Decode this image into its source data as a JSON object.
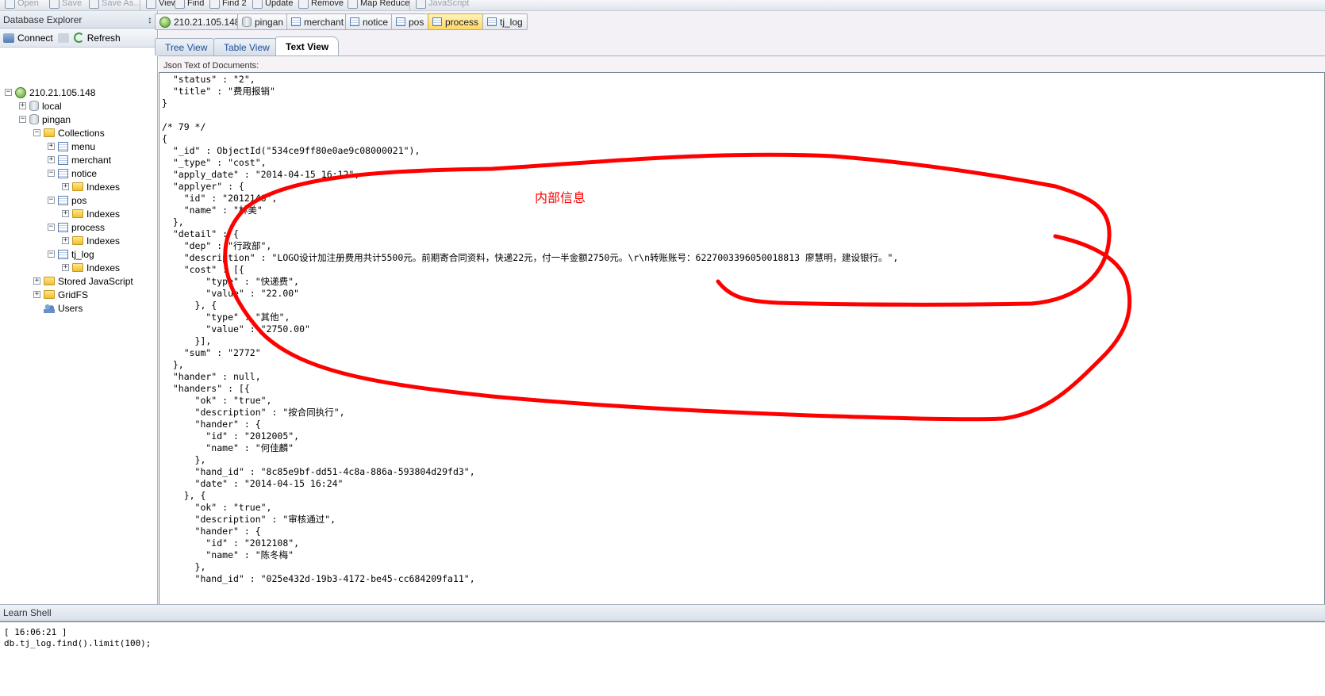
{
  "toolbar": {
    "items": [
      {
        "label": "Open",
        "enabled": false
      },
      {
        "label": "Save",
        "enabled": false
      },
      {
        "label": "Save As...",
        "enabled": false
      },
      {
        "label": "View",
        "enabled": true
      },
      {
        "label": "Find",
        "enabled": true
      },
      {
        "label": "Find 2",
        "enabled": true
      },
      {
        "label": "Update",
        "enabled": true
      },
      {
        "label": "Remove",
        "enabled": true
      },
      {
        "label": "Map Reduce",
        "enabled": true
      },
      {
        "label": "JavaScript",
        "enabled": false
      }
    ]
  },
  "explorer": {
    "title": "Database Explorer",
    "pin": "↕",
    "connect_label": "Connect",
    "refresh_label": "Refresh",
    "tree": [
      {
        "label": "210.21.105.148",
        "type": "server"
      },
      {
        "label": "local",
        "type": "db"
      },
      {
        "label": "pingan",
        "type": "db"
      },
      {
        "label": "Collections",
        "type": "folder"
      },
      {
        "label": "menu",
        "type": "collection"
      },
      {
        "label": "merchant",
        "type": "collection"
      },
      {
        "label": "notice",
        "type": "collection"
      },
      {
        "label": "Indexes",
        "type": "folder"
      },
      {
        "label": "pos",
        "type": "collection"
      },
      {
        "label": "Indexes",
        "type": "folder"
      },
      {
        "label": "process",
        "type": "collection"
      },
      {
        "label": "Indexes",
        "type": "folder"
      },
      {
        "label": "tj_log",
        "type": "collection"
      },
      {
        "label": "Indexes",
        "type": "folder"
      },
      {
        "label": "Stored JavaScript",
        "type": "folder"
      },
      {
        "label": "GridFS",
        "type": "folder"
      },
      {
        "label": "Users",
        "type": "users"
      }
    ]
  },
  "connection_tabs": [
    {
      "label": "210.21.105.148",
      "active": false
    },
    {
      "label": "pingan",
      "active": false
    },
    {
      "label": "merchant",
      "active": false
    },
    {
      "label": "notice",
      "active": false
    },
    {
      "label": "pos",
      "active": false
    },
    {
      "label": "process",
      "active": true
    },
    {
      "label": "tj_log",
      "active": false
    }
  ],
  "view_tabs": [
    {
      "label": "Tree View",
      "active": false
    },
    {
      "label": "Table View",
      "active": false
    },
    {
      "label": "Text View",
      "active": true
    }
  ],
  "text_view": {
    "label": "Json Text of Documents:",
    "lines": [
      "  \"status\" : \"2\",",
      "  \"title\" : \"费用报销\"",
      "}",
      "",
      "/* 79 */",
      "{",
      "  \"_id\" : ObjectId(\"534ce9ff80e0ae9c08000021\"),",
      "  \"_type\" : \"cost\",",
      "  \"apply_date\" : \"2014-04-15 16:12\",",
      "  \"applyer\" : {",
      "    \"id\" : \"2012146\",",
      "    \"name\" : \"林美\"",
      "  },",
      "  \"detail\" : {",
      "    \"dep\" : \"行政部\",",
      "    \"description\" : \"LOGO设计加注册费用共计5500元。前期寄合同资料，快递22元，付一半金额2750元。\\r\\n转账账号：6227003396050018813 廖慧明，建设银行。\",",
      "    \"cost\" : [{",
      "        \"type\" : \"快递费\",",
      "        \"value\" : \"22.00\"",
      "      }, {",
      "        \"type\" : \"其他\",",
      "        \"value\" : \"2750.00\"",
      "      }],",
      "    \"sum\" : \"2772\"",
      "  },",
      "  \"hander\" : null,",
      "  \"handers\" : [{",
      "      \"ok\" : \"true\",",
      "      \"description\" : \"按合同执行\",",
      "      \"hander\" : {",
      "        \"id\" : \"2012005\",",
      "        \"name\" : \"何佳麟\"",
      "      },",
      "      \"hand_id\" : \"8c85e9bf-dd51-4c8a-886a-593804d29fd3\",",
      "      \"date\" : \"2014-04-15 16:24\"",
      "    }, {",
      "      \"ok\" : \"true\",",
      "      \"description\" : \"审核通过\",",
      "      \"hander\" : {",
      "        \"id\" : \"2012108\",",
      "        \"name\" : \"陈冬梅\"",
      "      },",
      "      \"hand_id\" : \"025e432d-19b3-4172-be45-cc684209fa11\","
    ]
  },
  "annotation": {
    "label": "内部信息",
    "color": "#ff0000"
  },
  "shell": {
    "title": "Learn Shell",
    "lines": [
      "[ 16:06:21 ]",
      "db.tj_log.find().limit(100);"
    ]
  }
}
